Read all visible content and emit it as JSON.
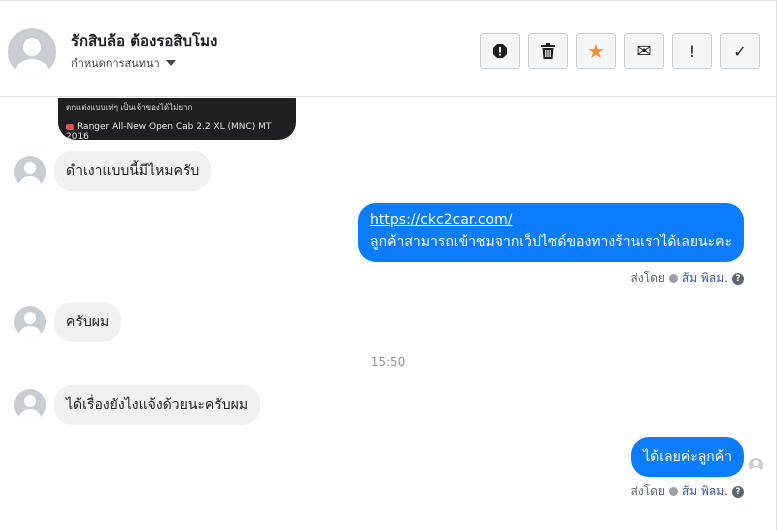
{
  "header": {
    "contact_name": "รักสิบล้อ ต้องรอสิบโมง",
    "convo_menu_label": "กำหนดการสนทนา",
    "actions": [
      {
        "icon": "report-icon",
        "glyph": "!"
      },
      {
        "icon": "trash-icon",
        "glyph": ""
      },
      {
        "icon": "star-icon",
        "glyph": "★"
      },
      {
        "icon": "mail-icon",
        "glyph": "✉"
      },
      {
        "icon": "exclamation-icon",
        "glyph": "!"
      },
      {
        "icon": "checkmark-icon",
        "glyph": "✓"
      }
    ],
    "star_color": "#f7923b"
  },
  "chat": {
    "card_line1": "ตกแต่งแบบเท่ๆ เป็นเจ้าของได้ไม่ยาก",
    "card_line2": "Ranger All-New Open Cab 2.2 XL (MNC) MT 2016",
    "messages": [
      {
        "from": "them",
        "text": "ดำเงาแบบนี้มีไหมครับ"
      },
      {
        "from": "me",
        "link": "https://ckc2car.com/",
        "text": "ลูกค้าสามารถเข้าชมจากเว็ปไซด์ของทางร้านเราได้เลยนะคะ"
      },
      {
        "from": "them",
        "text": "ครับผม"
      },
      {
        "from": "them",
        "text": "ได้เรื่องยังไงแจ้งด้วยนะครับผม"
      },
      {
        "from": "me",
        "text": "ได้เลยค่ะลูกค้า"
      }
    ],
    "sent_by_label": "ส่งโดย",
    "sender_name": "ส้ม พิลม.",
    "help_glyph": "?",
    "timestamp": "15:50",
    "outgoing_color": "#0a7cff",
    "incoming_color": "#f1f0f0"
  }
}
